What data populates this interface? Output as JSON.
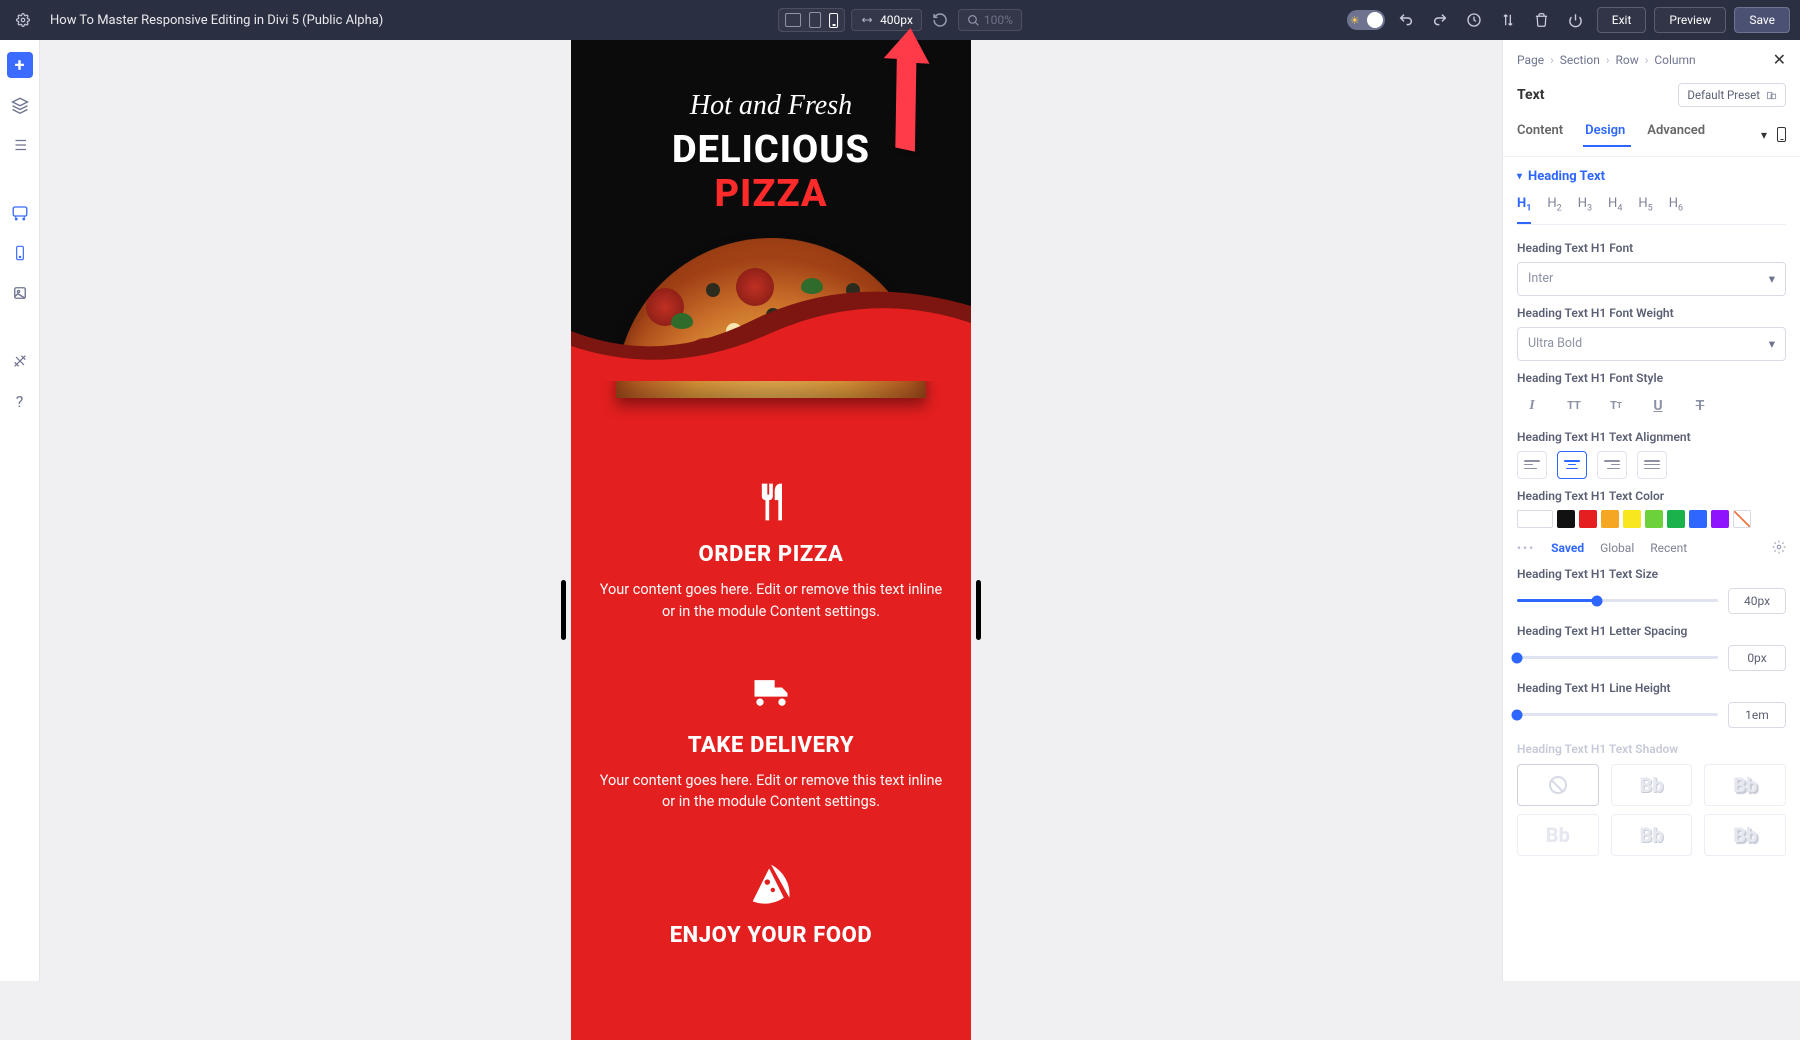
{
  "title": "How To Master Responsive Editing in Divi 5 (Public Alpha)",
  "toolbar": {
    "width_value": "400px",
    "zoom_placeholder": "100%",
    "exit": "Exit",
    "preview": "Preview",
    "save": "Save"
  },
  "canvas": {
    "hero": {
      "script": "Hot and Fresh",
      "line1": "DELICIOUS",
      "line2": "PIZZA"
    },
    "features": [
      {
        "title": "ORDER PIZZA",
        "body": "Your content goes here. Edit or remove this text inline or in the module Content settings."
      },
      {
        "title": "TAKE DELIVERY",
        "body": "Your content goes here. Edit or remove this text inline or in the module Content settings."
      },
      {
        "title": "ENJOY YOUR FOOD",
        "body": ""
      }
    ]
  },
  "panel": {
    "breadcrumbs": [
      "Page",
      "Section",
      "Row",
      "Column"
    ],
    "module_name": "Text",
    "preset_label": "Default Preset",
    "tabs": {
      "content": "Content",
      "design": "Design",
      "advanced": "Advanced"
    },
    "section": "Heading Text",
    "heading_levels": [
      "H",
      "H",
      "H",
      "H",
      "H",
      "H"
    ],
    "heading_subs": [
      "1",
      "2",
      "3",
      "4",
      "5",
      "6"
    ],
    "labels": {
      "font": "Heading Text H1 Font",
      "font_val": "Inter",
      "weight": "Heading Text H1 Font Weight",
      "weight_val": "Ultra Bold",
      "style": "Heading Text H1 Font Style",
      "align": "Heading Text H1 Text Alignment",
      "color": "Heading Text H1 Text Color",
      "size": "Heading Text H1 Text Size",
      "size_val": "40px",
      "spacing": "Heading Text H1 Letter Spacing",
      "spacing_val": "0px",
      "lineheight": "Heading Text H1 Line Height",
      "lineheight_val": "1em",
      "shadow": "Heading Text H1 Text Shadow"
    },
    "color_swatches": [
      "#ffffff",
      "#111111",
      "#e51f1f",
      "#f5a623",
      "#f8e71c",
      "#6dd13b",
      "#19b24b",
      "#2e67ff",
      "#9013fe"
    ],
    "color_tabs": {
      "saved": "Saved",
      "global": "Global",
      "recent": "Recent"
    },
    "shadow_text": "Bb"
  }
}
